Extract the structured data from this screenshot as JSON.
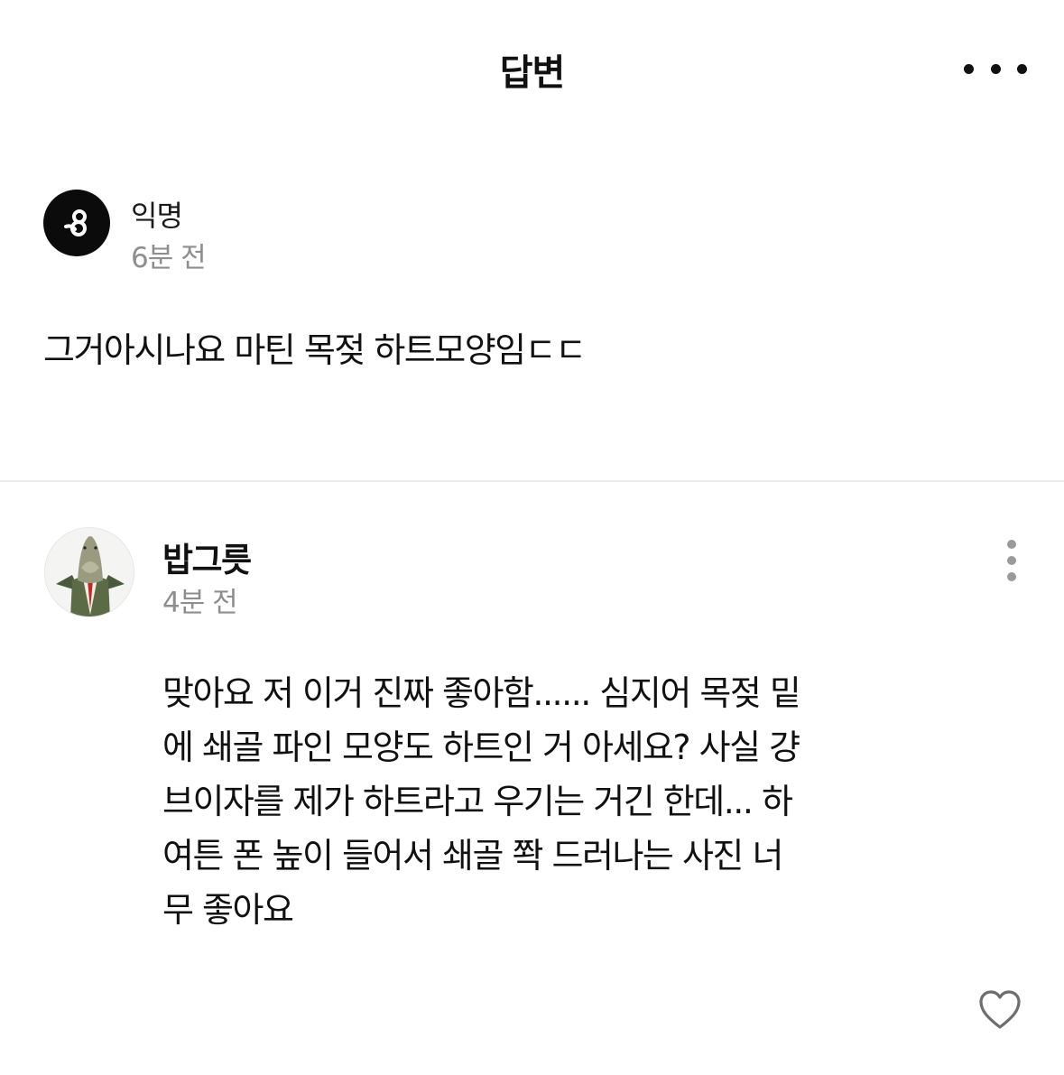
{
  "header": {
    "title": "답변",
    "more_icon": "more-horizontal-icon"
  },
  "post": {
    "author": "익명",
    "time": "6분 전",
    "avatar_icon": "anonymous-logo-icon",
    "body": "그거아시나요 마틴 목젖 하트모양임ㄷㄷ"
  },
  "reply": {
    "author": "밥그릇",
    "time": "4분 전",
    "avatar": "fish-head-in-suit-avatar",
    "more_icon": "more-vertical-icon",
    "body_lines": [
      "맞아요 저 이거 진짜 좋아함...... 심지어 목젖 밑",
      "에 쇄골 파인 모양도 하트인 거 아세요? 사실 걍",
      "브이자를 제가 하트라고 우기는 거긴 한데... 하",
      "여튼 폰 높이 들어서 쇄골 쫙 드러나는 사진 너",
      "무 좋아요"
    ],
    "like_icon": "heart-outline-icon"
  },
  "colors": {
    "text": "#111111",
    "muted": "#8e8e8e",
    "divider": "#ececec",
    "icon_gray": "#9a9a9a"
  }
}
